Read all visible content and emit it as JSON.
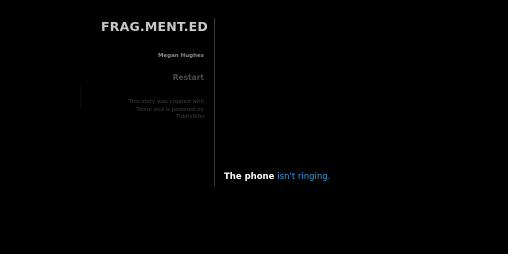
{
  "sidebar": {
    "title": "FRAG.MENT.ED",
    "author": "Megan Hughes",
    "restart_label": "Restart",
    "credits_lines": [
      "This story was created with",
      "Twine and is powered by",
      "TiddlyWiki"
    ]
  },
  "passage": {
    "plain_text": "The phone ",
    "link_text": "isn't ringing",
    "punctuation": "."
  },
  "colors": {
    "background": "#000000",
    "link": "#3a9ad8",
    "text": "#ffffff"
  }
}
